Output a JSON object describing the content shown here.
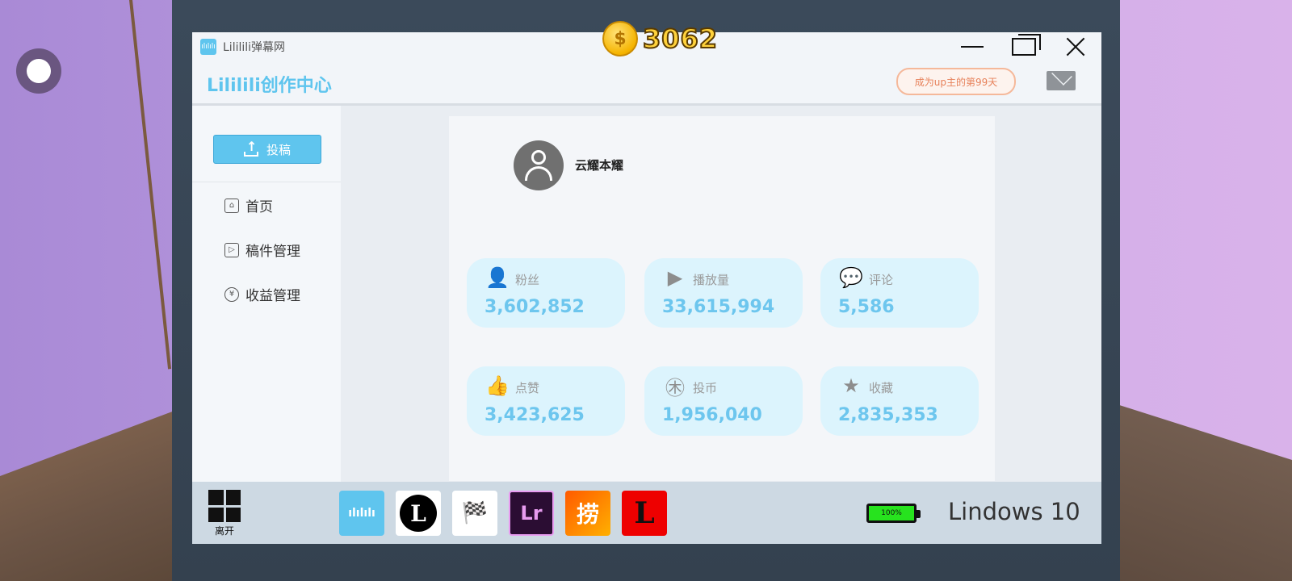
{
  "hud": {
    "coin_symbol": "$",
    "coins": "3062"
  },
  "window": {
    "title": "Lililili弹幕网",
    "logo_text": "ılılılı"
  },
  "header": {
    "app_title": "Lililili创作中心",
    "badge": "成为up主的第99天"
  },
  "sidebar": {
    "upload_label": "投稿",
    "items": [
      {
        "label": "首页",
        "icon": "home-icon"
      },
      {
        "label": "稿件管理",
        "icon": "video-icon"
      },
      {
        "label": "收益管理",
        "icon": "money-bag-icon"
      }
    ]
  },
  "profile": {
    "username": "云耀本耀"
  },
  "stats": [
    {
      "label": "粉丝",
      "value": "3,602,852",
      "icon": "user-icon"
    },
    {
      "label": "播放量",
      "value": "33,615,994",
      "icon": "play-icon"
    },
    {
      "label": "评论",
      "value": "5,586",
      "icon": "comment-icon"
    },
    {
      "label": "点赞",
      "value": "3,423,625",
      "icon": "thumbs-up-icon"
    },
    {
      "label": "投币",
      "value": "1,956,040",
      "icon": "coin-icon"
    },
    {
      "label": "收藏",
      "value": "2,835,353",
      "icon": "star-icon"
    }
  ],
  "taskbar": {
    "start_label": "离开",
    "apps": [
      {
        "name": "lililili-app",
        "glyph": "ılılılı",
        "bg": "#5fc5ee",
        "fg": "#ffffff"
      },
      {
        "name": "l-circle-app",
        "glyph": "L",
        "bg": "#ffffff",
        "fg": "#ffffff"
      },
      {
        "name": "racing-flags-app",
        "glyph": "🏁",
        "bg": "#ffffff",
        "fg": "#111111"
      },
      {
        "name": "lightroom-app",
        "glyph": "Lr",
        "bg": "#2b0d33",
        "fg": "#e89cf0"
      },
      {
        "name": "lao-app",
        "glyph": "捞",
        "bg": "#ff8a00",
        "fg": "#ffffff"
      },
      {
        "name": "l-red-app",
        "glyph": "L",
        "bg": "#ee0000",
        "fg": "#111111"
      }
    ],
    "battery": "100%",
    "os_name": "Lindows 10"
  },
  "colors": {
    "accent": "#5fc5ee",
    "stat_bg": "#dcf4fd",
    "badge": "#e7815a",
    "battery": "#27e31e"
  }
}
